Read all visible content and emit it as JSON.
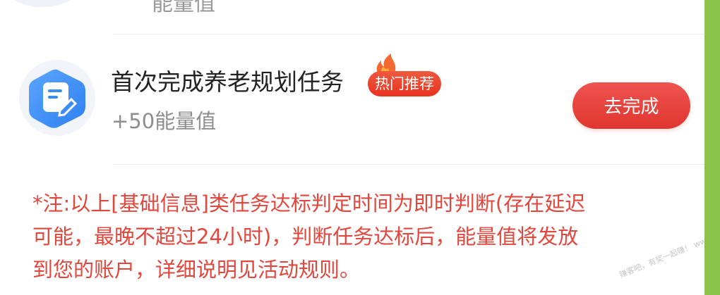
{
  "previous_task": {
    "reward": "能量值"
  },
  "task": {
    "icon": "task-note-icon",
    "title": "首次完成养老规划任务",
    "badge": "热门推荐",
    "reward": "+50能量值",
    "button_label": "去完成"
  },
  "note": {
    "lines": [
      "*注:以上[基础信息]类任务达标判定时间为即时判断(存在延迟",
      "可能，最晚不超过24小时)，判断任务达标后，能量值将发放",
      "到您的账户，详细说明见活动规则。"
    ]
  },
  "watermark": "赚客吧，有奖一起赚！ www.zuanke8.com",
  "colors": {
    "accent_red": "#e2473d",
    "button_red": "#e84a43",
    "side_strip_green": "#8bc34a",
    "icon_blue": "#3b8ef0"
  }
}
